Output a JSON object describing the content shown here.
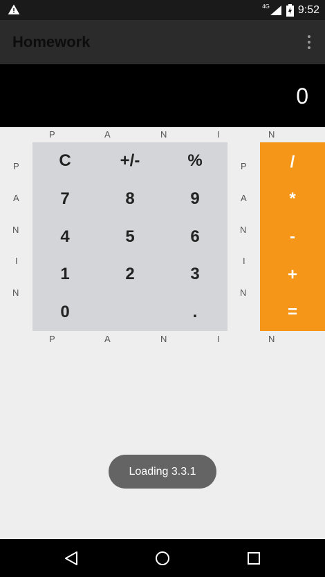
{
  "status_bar": {
    "network": "4G",
    "time": "9:52"
  },
  "app_bar": {
    "title": "Homework"
  },
  "display": {
    "value": "0"
  },
  "labels": {
    "top": [
      "P",
      "A",
      "N",
      "I",
      "N"
    ],
    "bottom": [
      "P",
      "A",
      "N",
      "I",
      "N"
    ],
    "left": [
      "P",
      "A",
      "N",
      "I",
      "N"
    ],
    "middle": [
      "P",
      "A",
      "N",
      "I",
      "N"
    ]
  },
  "keypad": {
    "keys": [
      "C",
      "+/-",
      "%",
      "7",
      "8",
      "9",
      "4",
      "5",
      "6",
      "1",
      "2",
      "3",
      "0",
      ".",
      ""
    ]
  },
  "operators": [
    "/",
    "*",
    "-",
    "+",
    "="
  ],
  "toast": {
    "text": "Loading 3.3.1"
  },
  "colors": {
    "operator_bg": "#f59618",
    "keypad_bg": "#d4d5d8",
    "display_bg": "#000000"
  }
}
